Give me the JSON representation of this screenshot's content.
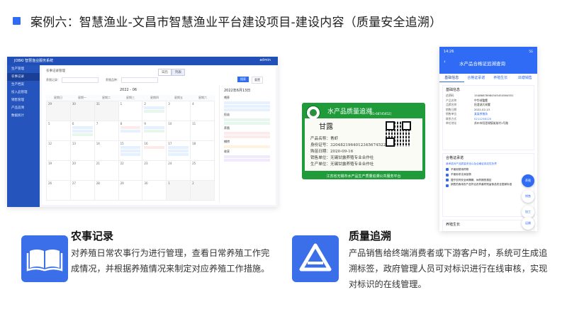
{
  "header": {
    "title": "案例六：智慧渔业-文昌市智慧渔业平台建设项目-建设内容（质量安全追溯）"
  },
  "app": {
    "name": "JOBKI 智慧渔业服务系统",
    "user": "admin",
    "sidebar": [
      "生产管理",
      "农事记录",
      "生产档案",
      "投入品管理",
      "销售管理",
      "产品追溯",
      "数据统计"
    ],
    "breadcrumb": "农事记录管理",
    "tabs": [
      "日历",
      "列表"
    ],
    "filters": {
      "label1": "养殖记录：",
      "label2": "养殖品种：",
      "search": "搜索",
      "reset": "重置"
    },
    "month": "2022 - 06",
    "weekdays": [
      "星期日",
      "星期一",
      "星期二",
      "星期三",
      "星期四",
      "星期五",
      "星期六"
    ],
    "days": [
      "29",
      "30",
      "31",
      "1",
      "2",
      "3",
      "4",
      "5",
      "6",
      "7",
      "8",
      "9",
      "10",
      "11",
      "12",
      "13",
      "14",
      "15",
      "16",
      "17",
      "18",
      "19",
      "20",
      "21",
      "22",
      "23",
      "24",
      "25",
      "26",
      "27",
      "28",
      "29",
      "30",
      "1",
      "2"
    ],
    "right_title": "2022年6月13日",
    "right_sections": [
      "喂养",
      "投苗",
      "养殖",
      "捕捞",
      "收获"
    ]
  },
  "cert": {
    "title": "水产品质量追溯",
    "subtitle": "[21-68745652]",
    "name": "甘露",
    "lines": [
      "产品名称：青虾",
      "身份证号：320482196401234567452212025",
      "购苗日期：2020-09-16",
      "销售单位：无锡甘露养殖专业合作社",
      "生产单位：无锡甘露养殖专业合作社"
    ],
    "footer": "江苏省无锡市水产品生产质量追溯公共服务平台"
  },
  "phone": {
    "time": "14:26",
    "signal": "5G",
    "title": "水产品合格证追溯查询",
    "tabs": [
      "基础信息",
      "合格证承诺",
      "养殖生长",
      "出塘销售"
    ],
    "basic": {
      "heading": "基础信息",
      "rows": [
        {
          "k": "追溯码",
          "v": "15486678984545454564551"
        },
        {
          "k": "产品名称",
          "v": "中华绒螯蟹"
        },
        {
          "k": "品牌名称",
          "v": "阳澄湖大闸蟹"
        },
        {
          "k": "销售日期",
          "v": "2022-02-13"
        },
        {
          "k": "销售单位",
          "v": "某某养殖场"
        },
        {
          "k": "联系方式",
          "v": "0211258120"
        },
        {
          "k": "单位地址",
          "v": "苏州市阳澄湖镇某某村1号路"
        }
      ]
    },
    "promise": {
      "heading": "合格证承诺",
      "intro": "我承诺对产品质量安全以及合格证真实性负责",
      "items": [
        "不使用禁用药物",
        "不使用非法添加物",
        "遵守农药安全间隔期、休药期的规定",
        "销售的食用农产品符合农药兽药残留食品安全国家标准"
      ]
    },
    "growth_heading": "养殖生长",
    "fabs": [
      "养殖",
      "销售",
      "加工",
      "运输"
    ]
  },
  "features": [
    {
      "title": "农事记录",
      "desc": "对养殖日常农事行为进行管理，查看日常养殖工作完成情况，并根据养殖情况来制定对应养殖工作措施。"
    },
    {
      "title": "质量追溯",
      "desc": "产品销售给终端消费者或下游客户时，系统可生成追溯标签，政府管理人员可对标识进行在线审核，实现对标识的在线管理。"
    }
  ],
  "colors": {
    "accent": "#2f6bf5",
    "icon_bg": "#3a6fe9",
    "cert_green": "#1f9b3a"
  }
}
